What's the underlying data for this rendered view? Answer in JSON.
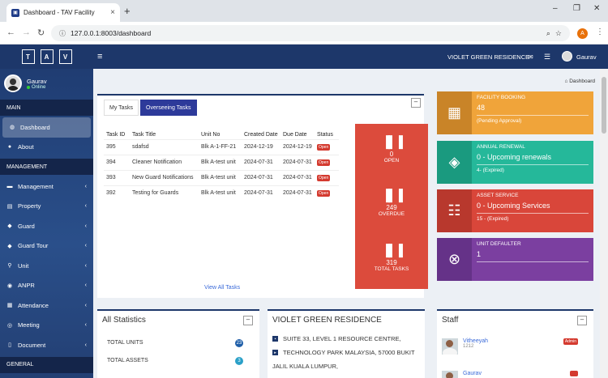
{
  "browser": {
    "tab_title": "Dashboard - TAV Facility",
    "url": "127.0.0.1:8003/dashboard",
    "profile_initial": "A"
  },
  "sidebar": {
    "brand_letters": [
      "T",
      "A",
      "V"
    ],
    "user_name": "Gaurav",
    "user_status": "Online",
    "sections": {
      "main": "MAIN",
      "management": "MANAGEMENT",
      "general": "GENERAL"
    },
    "main_items": [
      {
        "label": "Dashboard",
        "icon": "dashboard-icon"
      },
      {
        "label": "About",
        "icon": "info-icon"
      }
    ],
    "management_items": [
      {
        "label": "Management",
        "icon": "briefcase-icon"
      },
      {
        "label": "Property",
        "icon": "building-icon"
      },
      {
        "label": "Guard",
        "icon": "shield-icon"
      },
      {
        "label": "Guard Tour",
        "icon": "shield-icon"
      },
      {
        "label": "Unit",
        "icon": "location-icon"
      },
      {
        "label": "ANPR",
        "icon": "car-icon"
      },
      {
        "label": "Attendance",
        "icon": "calendar-icon"
      },
      {
        "label": "Meeting",
        "icon": "users-icon"
      },
      {
        "label": "Document",
        "icon": "file-icon"
      }
    ]
  },
  "topnav": {
    "site_name": "VIOLET GREEN RESIDENCE",
    "user_name": "Gaurav"
  },
  "breadcrumb": "Dashboard",
  "tasks_panel": {
    "tabs": [
      "My Tasks",
      "Overseeing Tasks"
    ],
    "headers": [
      "Task ID",
      "Task Title",
      "Unit No",
      "Created Date",
      "Due Date",
      "Status"
    ],
    "rows": [
      {
        "id": "395",
        "title": "sdafsd",
        "unit": "Blk A-1-FF-21",
        "created": "2024-12-19",
        "due": "2024-12-19",
        "status": "Open"
      },
      {
        "id": "394",
        "title": "Cleaner Notification",
        "unit": "Blk A-test unit",
        "created": "2024-07-31",
        "due": "2024-07-31",
        "status": "Open"
      },
      {
        "id": "393",
        "title": "New Guard Notifications",
        "unit": "Blk A-test unit",
        "created": "2024-07-31",
        "due": "2024-07-31",
        "status": "Open"
      },
      {
        "id": "392",
        "title": "Testing for Guards",
        "unit": "Blk A-test unit",
        "created": "2024-07-31",
        "due": "2024-07-31",
        "status": "Open"
      }
    ],
    "view_all": "View All Tasks",
    "stats": [
      {
        "value": "0",
        "label": "OPEN"
      },
      {
        "value": "249",
        "label": "OVERDUE"
      },
      {
        "value": "319",
        "label": "TOTAL TASKS"
      }
    ]
  },
  "info_boxes": [
    {
      "title": "FACILITY BOOKING",
      "number": "48",
      "desc": "(Pending Approval)",
      "color": "#f0a43a",
      "icon": "calendar-icon"
    },
    {
      "title": "ANNUAL RENEWAL",
      "number": "0 - Upcoming renewals",
      "desc": "4- (Expired)",
      "color": "#25b89a",
      "icon": "layers-icon"
    },
    {
      "title": "ASSET SERVICE",
      "number": "0 - Upcoming Services",
      "desc": "15 - (Expired)",
      "color": "#d9463a",
      "icon": "sliders-icon"
    },
    {
      "title": "UNIT DEFAULTER",
      "number": "1",
      "desc": "",
      "color": "#7b3fa0",
      "icon": "close-circle-icon"
    }
  ],
  "all_statistics": {
    "title": "All Statistics",
    "rows": [
      {
        "label": "TOTAL UNITS",
        "value": "23",
        "color": "#1e5ea8"
      },
      {
        "label": "TOTAL ASSETS",
        "value": "3",
        "color": "#2aa0c8"
      }
    ]
  },
  "residence": {
    "title": "VIOLET GREEN RESIDENCE",
    "address_lines": [
      "SUITE 33, LEVEL 1 RESOURCE CENTRE,",
      "TECHNOLOGY PARK MALAYSIA, 57000 BUKIT",
      "JALIL KUALA LUMPUR,"
    ]
  },
  "staff": {
    "title": "Staff",
    "members": [
      {
        "name": "Vitheeyah",
        "id": "1212",
        "role": "Admin"
      },
      {
        "name": "Gaurav",
        "id": "",
        "role": ""
      }
    ]
  }
}
